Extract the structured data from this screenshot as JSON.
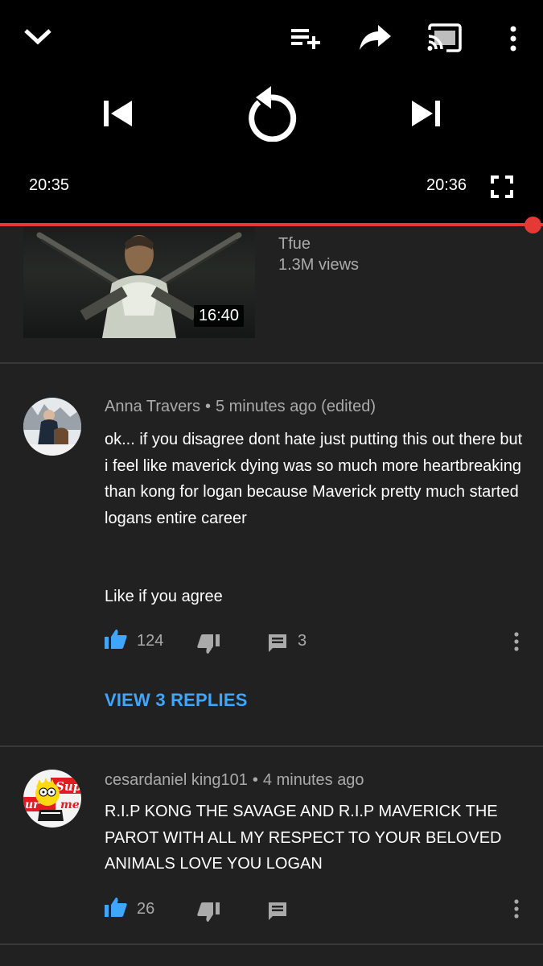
{
  "player": {
    "current_time": "20:35",
    "end_time": "20:36",
    "progress_fraction": 0.99
  },
  "video_card": {
    "duration": "16:40",
    "channel": "Tfue",
    "views": "1.3M views"
  },
  "comments": [
    {
      "author": "Anna Travers",
      "separator": "•",
      "time": "5 minutes ago (edited)",
      "text": "ok... if you disagree dont hate just putting this out there but i feel like maverick dying was so much more heartbreaking than kong for logan because Maverick pretty much started logans entire career\n\n\nLike if you agree",
      "likes": "124",
      "replies_count": "3",
      "view_replies": "VIEW 3 REPLIES"
    },
    {
      "author": "cesardaniel king101",
      "separator": "•",
      "time": "4 minutes ago",
      "text": "R.I.P KONG THE SAVAGE AND R.I.P MAVERICK THE PAROT WITH ALL MY RESPECT TO YOUR BELOVED ANIMALS LOVE YOU LOGAN",
      "likes": "26"
    }
  ],
  "colors": {
    "accent": "#3ea6ff",
    "progress": "#e53935",
    "background": "#212121"
  }
}
